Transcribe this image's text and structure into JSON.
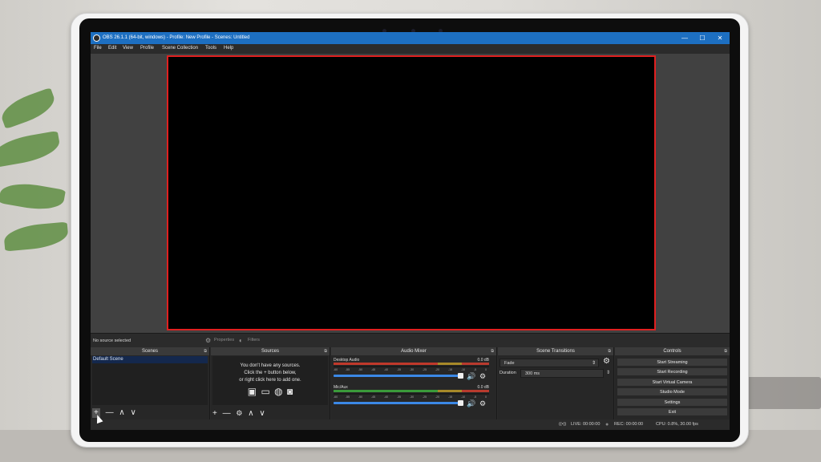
{
  "window": {
    "title": "OBS 26.1.1 (64-bit, windows) - Profile: New Profile - Scenes: Untitled",
    "minimize_glyph": "—",
    "maximize_glyph": "☐",
    "close_glyph": "✕"
  },
  "menu": [
    "File",
    "Edit",
    "View",
    "Profile",
    "Scene Collection",
    "Tools",
    "Help"
  ],
  "source_bar": {
    "status": "No source selected",
    "properties_label": "Properties",
    "filters_label": "Filters"
  },
  "docks": {
    "scenes": {
      "title": "Scenes",
      "items": [
        "Default Scene"
      ]
    },
    "sources": {
      "title": "Sources",
      "empty_line1": "You don't have any sources.",
      "empty_line2": "Click the + button below,",
      "empty_line3": "or right click here to add one."
    },
    "mixer": {
      "title": "Audio Mixer",
      "channels": [
        {
          "name": "Desktop Audio",
          "db": "0.0 dB"
        },
        {
          "name": "Mic/Aux",
          "db": "0.0 dB"
        }
      ],
      "scale": [
        "-60",
        "-55",
        "-50",
        "-45",
        "-40",
        "-35",
        "-30",
        "-25",
        "-20",
        "-15",
        "-10",
        "-5",
        "0"
      ]
    },
    "transitions": {
      "title": "Scene Transitions",
      "selected": "Fade",
      "duration_label": "Duration",
      "duration_value": "300 ms"
    },
    "controls": {
      "title": "Controls",
      "buttons": [
        "Start Streaming",
        "Start Recording",
        "Start Virtual Camera",
        "Studio Mode",
        "Settings",
        "Exit"
      ]
    }
  },
  "status": {
    "live": "LIVE: 00:00:00",
    "rec": "REC: 00:00:00",
    "cpu": "CPU: 0.8%, 30.00 fps"
  },
  "icons": {
    "add": "+",
    "remove": "—",
    "up": "∧",
    "down": "∨",
    "gear": "⚙",
    "speaker": "🔊",
    "undock": "⧉"
  },
  "colors": {
    "titlebar": "#1d6fc1",
    "preview_border": "#e02020",
    "selected_scene": "#14284d",
    "volume_slider": "#3b88e6"
  }
}
